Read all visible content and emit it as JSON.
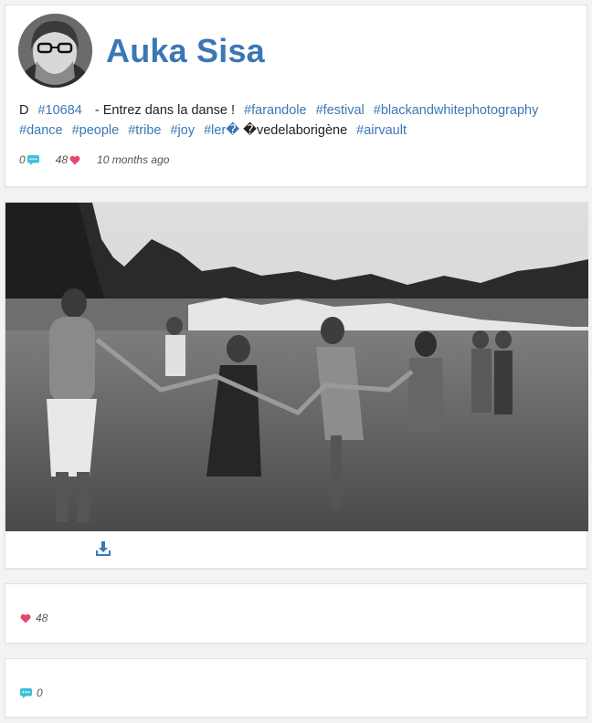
{
  "post": {
    "username": "Auka Sisa",
    "caption_parts": [
      {
        "text": "D",
        "type": "plain"
      },
      {
        "text": "#10684",
        "type": "tag"
      },
      {
        "text": " - Entrez dans la danse !",
        "type": "plain"
      },
      {
        "text": "#farandole",
        "type": "tag"
      },
      {
        "text": "#festival",
        "type": "tag"
      },
      {
        "text": "#blackandwhitephotography",
        "type": "tag"
      },
      {
        "text": "#dance",
        "type": "tag"
      },
      {
        "text": "#people",
        "type": "tag"
      },
      {
        "text": "#tribe",
        "type": "tag"
      },
      {
        "text": "#joy",
        "type": "tag"
      },
      {
        "text": "#ler�",
        "type": "tag"
      },
      {
        "text": "�vedelaborigène",
        "type": "plain"
      },
      {
        "text": "#airvault",
        "type": "tag"
      }
    ],
    "comment_count": "0",
    "like_count": "48",
    "time_ago": "10 months ago"
  },
  "likes_panel": {
    "count": "48"
  },
  "comments_panel": {
    "count": "0"
  },
  "icons": {
    "comment": "comment-bubble-icon",
    "like": "heart-icon",
    "download": "download-icon"
  },
  "colors": {
    "accent": "#3a78b5",
    "heart": "#e8476b",
    "comment": "#3cc0d8"
  }
}
